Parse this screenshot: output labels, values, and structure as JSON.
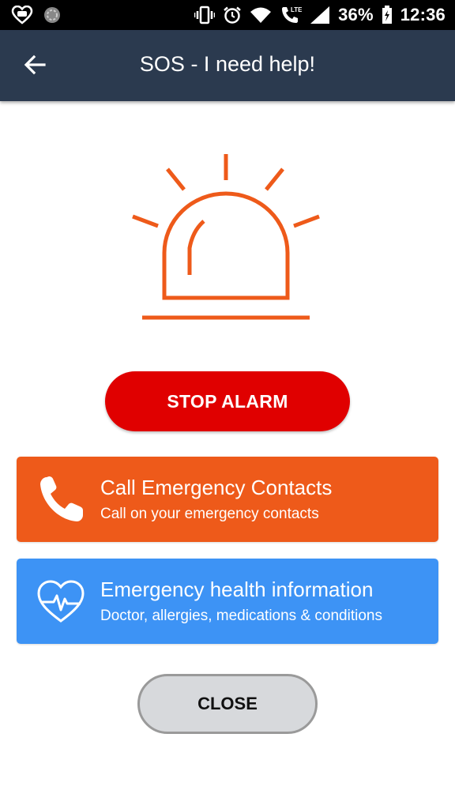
{
  "status_bar": {
    "left_icons": [
      "heart-chat-icon",
      "spinner-icon"
    ],
    "right_icons": [
      "vibrate-icon",
      "alarm-clock-icon",
      "wifi-icon",
      "lte-call-icon",
      "signal-icon"
    ],
    "battery_percent": "36%",
    "time": "12:36"
  },
  "app_bar": {
    "back_icon": "arrow-left-icon",
    "title": "SOS - I need help!"
  },
  "alarm": {
    "icon": "siren-icon",
    "color": "#ee5a1a"
  },
  "stop_alarm": {
    "label": "STOP ALARM",
    "color": "#e00000"
  },
  "cards": {
    "call": {
      "title": "Call Emergency Contacts",
      "subtitle": "Call on your emergency contacts",
      "icon": "phone-icon",
      "color": "#ee5a1a"
    },
    "health": {
      "title": "Emergency health information",
      "subtitle": "Doctor, allergies, medications & conditions",
      "icon": "heart-pulse-icon",
      "color": "#3d93f5"
    }
  },
  "close": {
    "label": "CLOSE"
  },
  "colors": {
    "app_bar": "#2b3a4f",
    "status_bar": "#000000"
  }
}
